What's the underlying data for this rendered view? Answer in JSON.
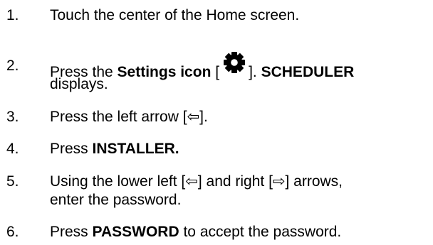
{
  "steps": [
    {
      "number": "1.",
      "text": "Touch the center of the Home screen."
    },
    {
      "number": "2.",
      "pre": "Press the ",
      "bold1": "Settings icon",
      "bracket_open": " [",
      "bracket_close": "]. ",
      "bold2": "SCHEDULER",
      "line2": "displays.",
      "icon": "gear-icon"
    },
    {
      "number": "3.",
      "text": "Press the left arrow [⇦]."
    },
    {
      "number": "4.",
      "pre": "Press ",
      "bold1": "INSTALLER."
    },
    {
      "number": "5.",
      "line1": "Using the lower left [⇦] and right [⇨] arrows,",
      "line2": "enter the password."
    },
    {
      "number": "6.",
      "pre": "Press ",
      "bold1": "PASSWORD",
      "post": " to accept the password."
    }
  ]
}
